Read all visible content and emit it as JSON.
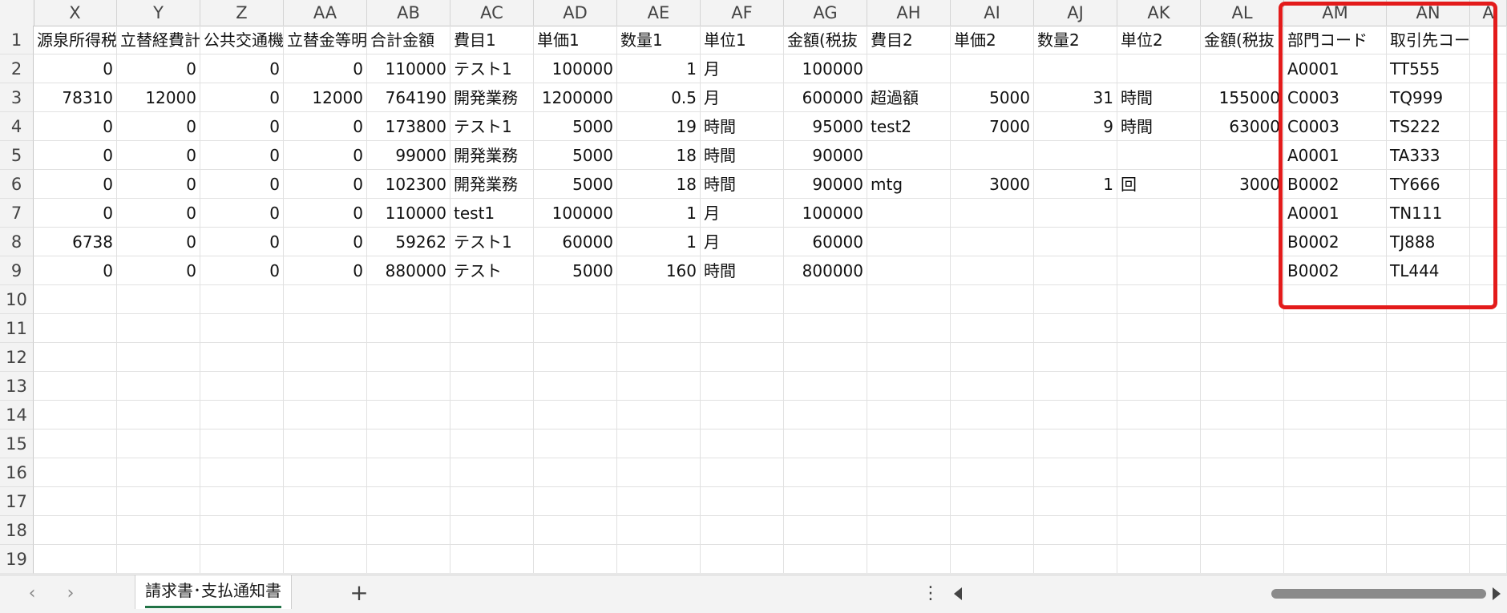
{
  "columns": [
    {
      "id": "X",
      "w": 104
    },
    {
      "id": "Y",
      "w": 104
    },
    {
      "id": "Z",
      "w": 104
    },
    {
      "id": "AA",
      "w": 104
    },
    {
      "id": "AB",
      "w": 104
    },
    {
      "id": "AC",
      "w": 104
    },
    {
      "id": "AD",
      "w": 104
    },
    {
      "id": "AE",
      "w": 104
    },
    {
      "id": "AF",
      "w": 104
    },
    {
      "id": "AG",
      "w": 104
    },
    {
      "id": "AH",
      "w": 104
    },
    {
      "id": "AI",
      "w": 104
    },
    {
      "id": "AJ",
      "w": 104
    },
    {
      "id": "AK",
      "w": 104
    },
    {
      "id": "AL",
      "w": 104
    },
    {
      "id": "AM",
      "w": 128
    },
    {
      "id": "AN",
      "w": 104
    },
    {
      "id": "A",
      "w": 46
    }
  ],
  "row_numbers": [
    "1",
    "2",
    "3",
    "4",
    "5",
    "6",
    "7",
    "8",
    "9",
    "10",
    "11",
    "12",
    "13",
    "14",
    "15",
    "16",
    "17",
    "18",
    "19"
  ],
  "cells": [
    [
      "源泉所得税",
      "立替経費計",
      "公共交通機",
      "立替金等明",
      "合計金額",
      "費目1",
      "単価1",
      "数量1",
      "単位1",
      "金額(税抜",
      "費目2",
      "単価2",
      "数量2",
      "単位2",
      "金額(税抜",
      "部門コード",
      "取引先コード",
      ""
    ],
    [
      "0",
      "0",
      "0",
      "0",
      "110000",
      "テスト1",
      "100000",
      "1",
      "月",
      "100000",
      "",
      "",
      "",
      "",
      "",
      "A0001",
      "TT555",
      ""
    ],
    [
      "78310",
      "12000",
      "0",
      "12000",
      "764190",
      "開発業務",
      "1200000",
      "0.5",
      "月",
      "600000",
      "超過額",
      "5000",
      "31",
      "時間",
      "155000",
      "C0003",
      "TQ999",
      ""
    ],
    [
      "0",
      "0",
      "0",
      "0",
      "173800",
      "テスト1",
      "5000",
      "19",
      "時間",
      "95000",
      "test2",
      "7000",
      "9",
      "時間",
      "63000",
      "C0003",
      "TS222",
      ""
    ],
    [
      "0",
      "0",
      "0",
      "0",
      "99000",
      "開発業務",
      "5000",
      "18",
      "時間",
      "90000",
      "",
      "",
      "",
      "",
      "",
      "A0001",
      "TA333",
      ""
    ],
    [
      "0",
      "0",
      "0",
      "0",
      "102300",
      "開発業務",
      "5000",
      "18",
      "時間",
      "90000",
      "mtg",
      "3000",
      "1",
      "回",
      "3000",
      "B0002",
      "TY666",
      ""
    ],
    [
      "0",
      "0",
      "0",
      "0",
      "110000",
      "test1",
      "100000",
      "1",
      "月",
      "100000",
      "",
      "",
      "",
      "",
      "",
      "A0001",
      "TN111",
      ""
    ],
    [
      "6738",
      "0",
      "0",
      "0",
      "59262",
      "テスト1",
      "60000",
      "1",
      "月",
      "60000",
      "",
      "",
      "",
      "",
      "",
      "B0002",
      "TJ888",
      ""
    ],
    [
      "0",
      "0",
      "0",
      "0",
      "880000",
      "テスト",
      "5000",
      "160",
      "時間",
      "800000",
      "",
      "",
      "",
      "",
      "",
      "B0002",
      "TL444",
      ""
    ]
  ],
  "sheet_tab": {
    "label": "請求書･支払通知書"
  },
  "add_sheet_label": "+",
  "more_label": "⋮",
  "nav": {
    "prev": "‹",
    "next": "›"
  },
  "colors": {
    "highlight": "#e31b1b",
    "tab_underline": "#217346"
  }
}
